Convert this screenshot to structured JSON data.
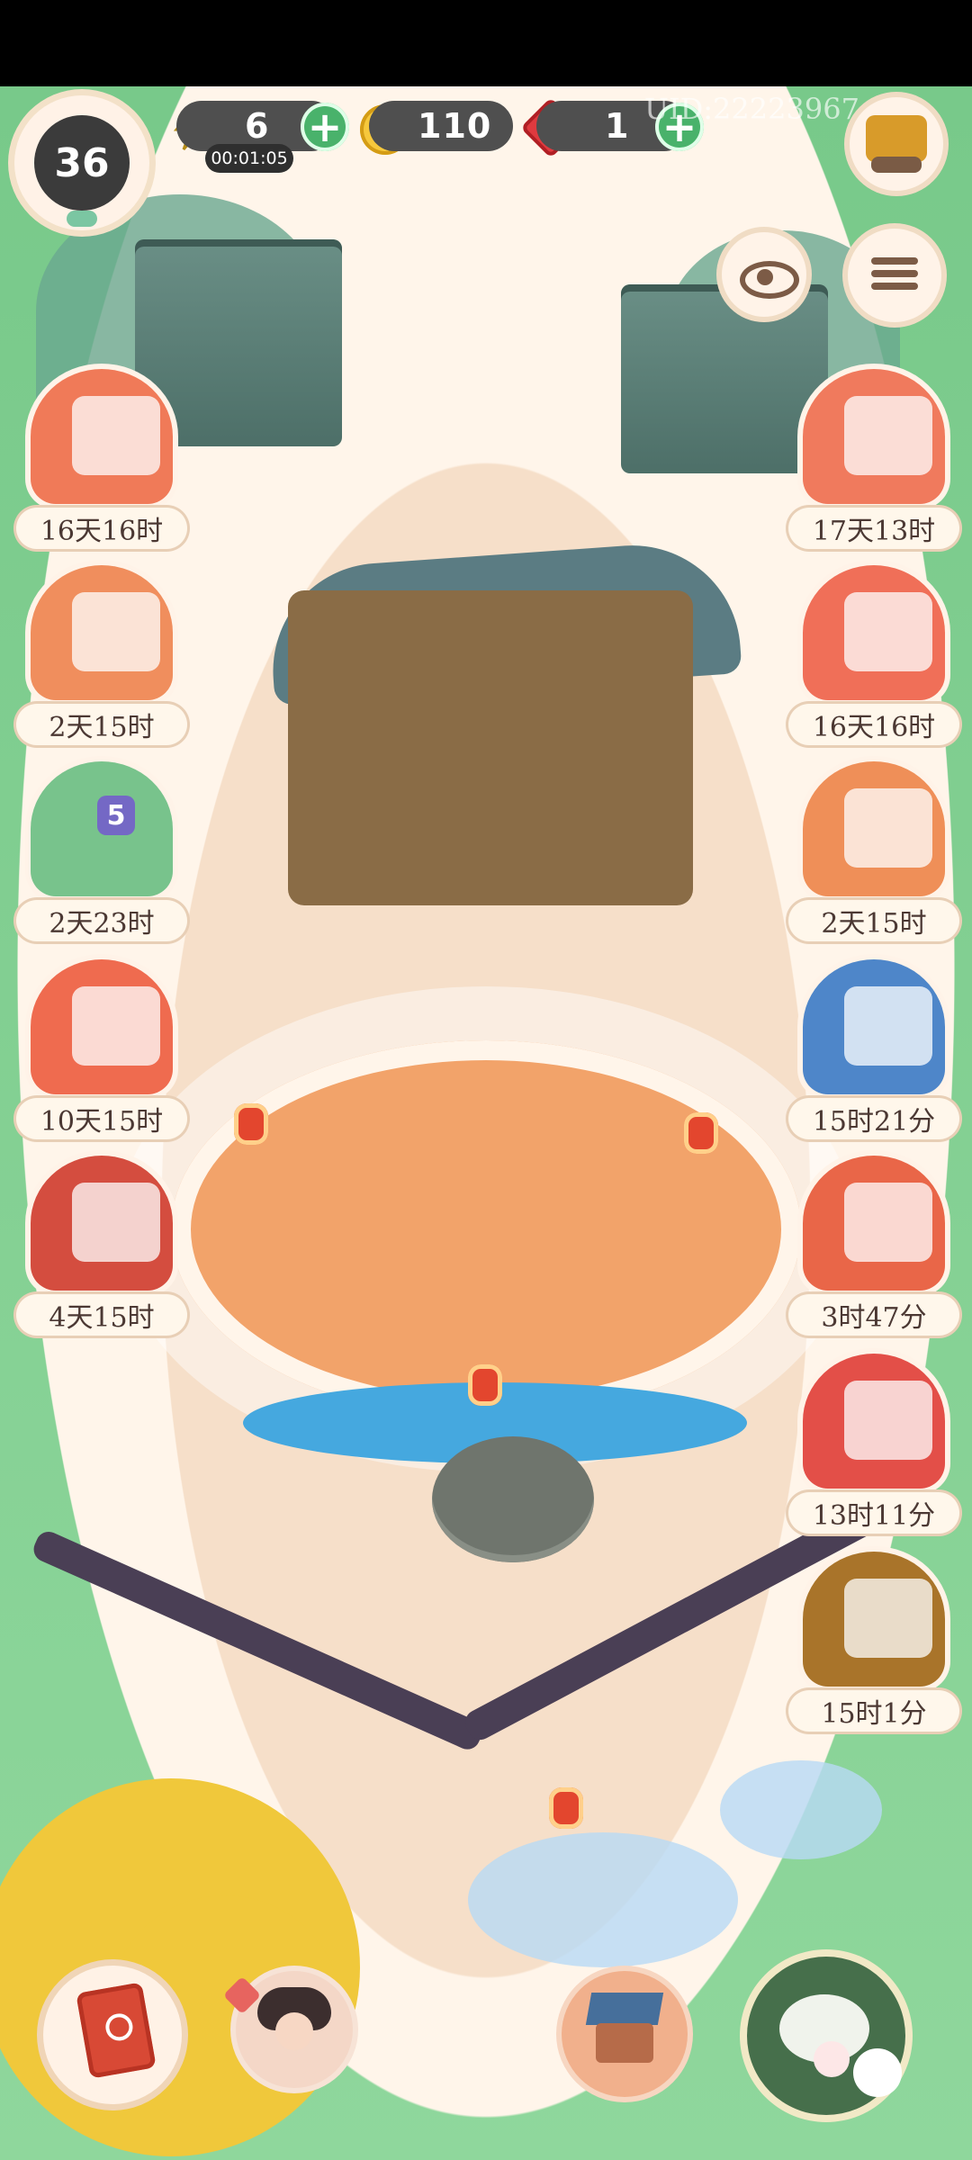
{
  "status_bar": {
    "level": "36",
    "energy": "6",
    "energy_timer": "00:01:05",
    "coins": "110",
    "gems": "1",
    "uid": "UID:22223967",
    "plus_label": "+"
  },
  "icons": {
    "energy": "lightning-icon",
    "coin": "coin-icon",
    "gem": "gem-icon",
    "shop": "shop-icon",
    "view": "eye-icon",
    "menu": "menu-icon"
  },
  "events": {
    "left": [
      {
        "label": "16天16时"
      },
      {
        "label": "2天15时"
      },
      {
        "label": "2天23时",
        "badge": "5"
      },
      {
        "label": "10天15时"
      },
      {
        "label": "4天15时"
      }
    ],
    "right": [
      {
        "label": "17天13时"
      },
      {
        "label": "16天16时"
      },
      {
        "label": "2天15时"
      },
      {
        "label": "15时21分"
      },
      {
        "label": "3时47分"
      },
      {
        "label": "13时11分"
      },
      {
        "label": "15时1分"
      }
    ]
  },
  "colors": {
    "green_button": "#49b26b",
    "currency_bg": "#4f4f4f",
    "label_bg": "#fff7eb",
    "label_text": "#4b3833"
  }
}
